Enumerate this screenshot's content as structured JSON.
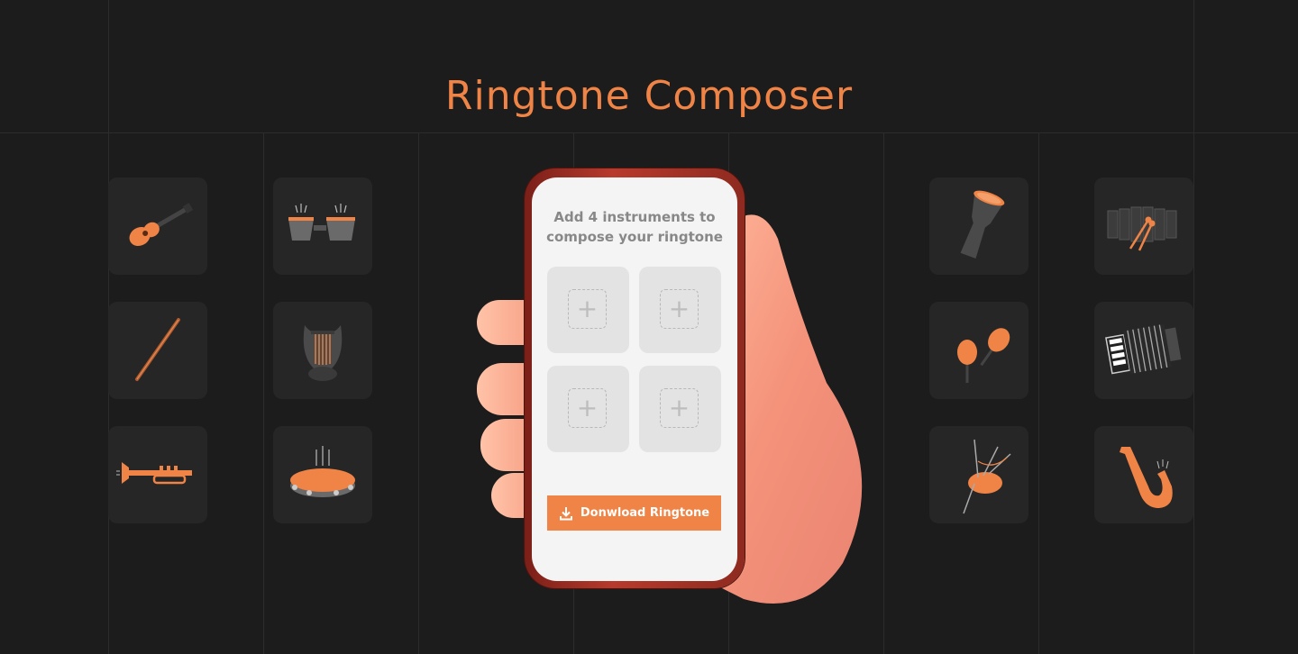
{
  "page": {
    "title": "Ringtone Composer"
  },
  "composer": {
    "prompt": "Add 4 instruments to\ncompose your ringtone",
    "slots": [
      {
        "symbol": "+"
      },
      {
        "symbol": "+"
      },
      {
        "symbol": "+"
      },
      {
        "symbol": "+"
      }
    ],
    "download_label": "Donwload Ringtone"
  },
  "instruments": [
    {
      "name": "ukulele-icon"
    },
    {
      "name": "bongo-drums-icon"
    },
    {
      "name": "flute-icon"
    },
    {
      "name": "lyre-icon"
    },
    {
      "name": "trumpet-icon"
    },
    {
      "name": "tambourine-icon"
    },
    {
      "name": "djembe-icon"
    },
    {
      "name": "xylophone-icon"
    },
    {
      "name": "maracas-icon"
    },
    {
      "name": "accordion-icon"
    },
    {
      "name": "bagpipes-icon"
    },
    {
      "name": "saxophone-icon"
    }
  ],
  "colors": {
    "accent": "#ef8446",
    "background": "#1c1c1c",
    "tile": "#262626",
    "screen": "#f4f4f4",
    "phone_case": "#b83a2c"
  }
}
